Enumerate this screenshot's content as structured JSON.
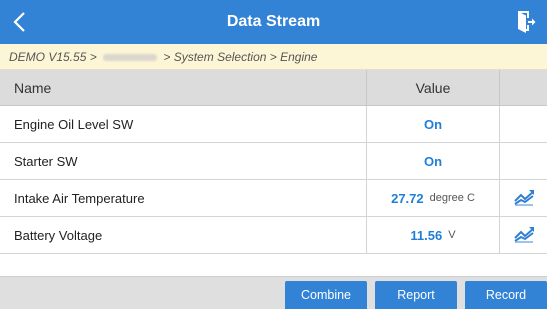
{
  "titlebar": {
    "title": "Data Stream",
    "back_icon": "chevron-left-icon",
    "exit_icon": "exit-door-icon"
  },
  "breadcrumb": {
    "prefix": "DEMO V15.55 > ",
    "suffix": " > System Selection > Engine"
  },
  "table": {
    "columns": [
      "Name",
      "Value"
    ],
    "rows": [
      {
        "name": "Engine Oil Level SW",
        "value": "On",
        "unit": ""
      },
      {
        "name": "Starter SW",
        "value": "On",
        "unit": ""
      },
      {
        "name": "Intake Air Temperature",
        "value": "27.72",
        "unit": "degree C"
      },
      {
        "name": "Battery Voltage",
        "value": "11.56",
        "unit": "V"
      }
    ]
  },
  "buttons": {
    "combine": "Combine",
    "report": "Report",
    "record": "Record"
  },
  "colors": {
    "primary": "#3282d6",
    "value_text": "#1f7fd8",
    "breadcrumb_bg": "#fdf6d6"
  }
}
